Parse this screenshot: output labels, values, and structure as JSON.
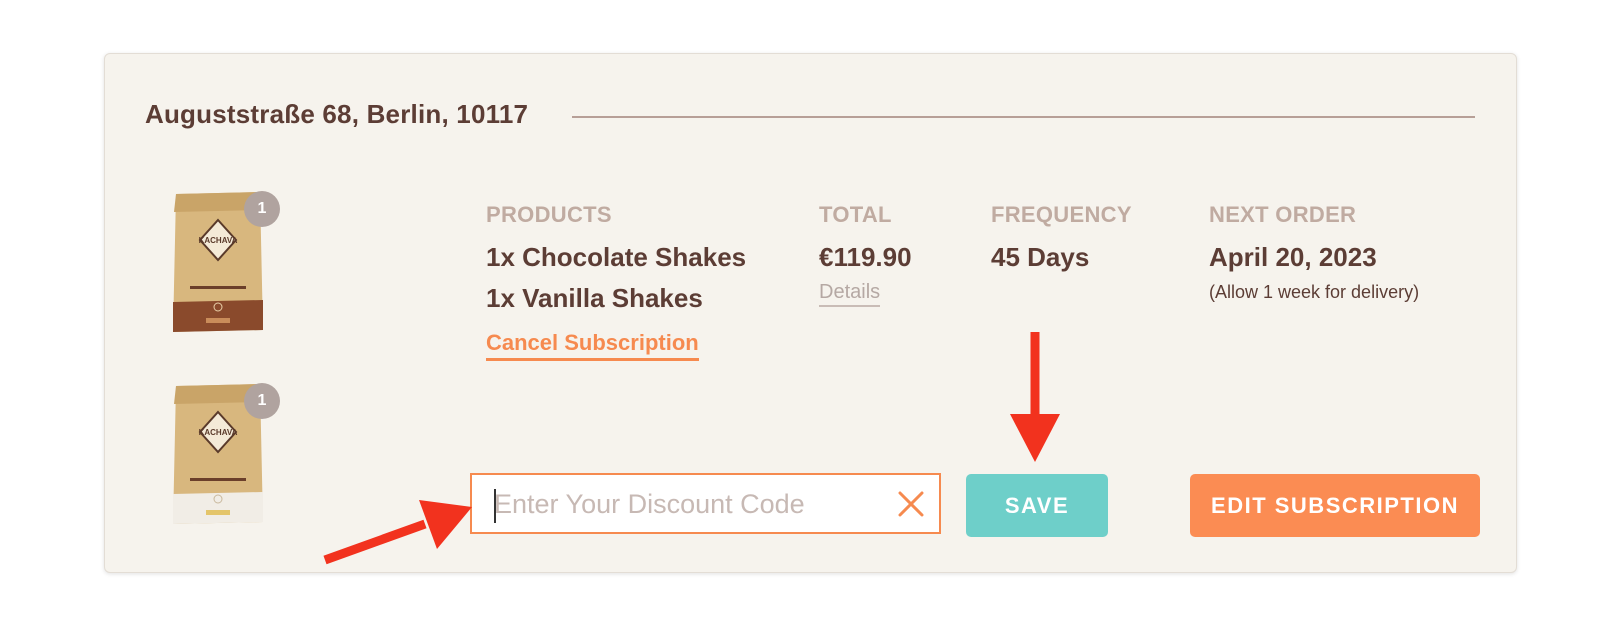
{
  "address": "Auguststraße 68, Berlin, 10117",
  "products": {
    "header": "PRODUCTS",
    "items": [
      "1x Chocolate Shakes",
      "1x Vanilla Shakes"
    ],
    "images": [
      {
        "brand": "KACHAVA",
        "quantity": "1",
        "flavor": "chocolate"
      },
      {
        "brand": "KACHAVA",
        "quantity": "1",
        "flavor": "vanilla"
      }
    ]
  },
  "total": {
    "header": "TOTAL",
    "value": "€119.90",
    "details_label": "Details"
  },
  "frequency": {
    "header": "FREQUENCY",
    "value": "45 Days"
  },
  "next_order": {
    "header": "NEXT ORDER",
    "date": "April 20, 2023",
    "note": "(Allow 1 week for delivery)"
  },
  "cancel_label": "Cancel Subscription",
  "discount": {
    "placeholder": "Enter Your Discount Code",
    "value": ""
  },
  "buttons": {
    "save": "SAVE",
    "edit": "EDIT SUBSCRIPTION"
  },
  "colors": {
    "accent_orange": "#fb8c53",
    "accent_teal": "#6ecfc9",
    "text_brown": "#5c3d35",
    "header_tan": "#c0aba1",
    "card_bg": "#f6f3ed",
    "annotation_red": "#f2321e"
  },
  "icons": {
    "clear": "close-icon",
    "annotation": "arrow-icon"
  }
}
